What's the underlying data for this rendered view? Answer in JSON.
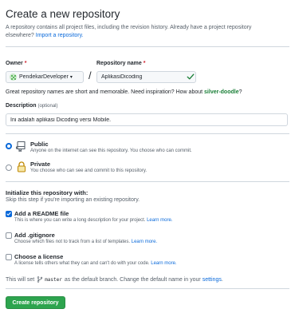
{
  "header": {
    "title": "Create a new repository",
    "subtitle": "A repository contains all project files, including the revision history. Already have a project repository elsewhere?",
    "import_link": "Import a repository."
  },
  "owner": {
    "label": "Owner",
    "required_mark": "*",
    "value": "PendekarDeveloper",
    "caret": "▾"
  },
  "separator": "/",
  "repo_name": {
    "label": "Repository name",
    "required_mark": "*",
    "value": "AplikasiDicoding",
    "valid_icon": "check-icon",
    "valid_color": "#1a7f37"
  },
  "hint": {
    "text": "Great repository names are short and memorable. Need inspiration? How about",
    "suggestion": "silver-doodle",
    "end": "?"
  },
  "description": {
    "label": "Description",
    "optional": "(optional)",
    "value": "Ini adalah aplikasi Dicoding versi Mobile."
  },
  "visibility": {
    "options": [
      {
        "title": "Public",
        "desc": "Anyone on the internet can see this repository. You choose who can commit.",
        "selected": true,
        "icon": "repo-icon"
      },
      {
        "title": "Private",
        "desc": "You choose who can see and commit to this repository.",
        "selected": false,
        "icon": "lock-icon"
      }
    ]
  },
  "initialize": {
    "heading": "Initialize this repository with:",
    "sub": "Skip this step if you're importing an existing repository.",
    "options": [
      {
        "title": "Add a README file",
        "desc": "This is where you can write a long description for your project.",
        "link": "Learn more.",
        "checked": true
      },
      {
        "title": "Add .gitignore",
        "desc": "Choose which files not to track from a list of templates.",
        "link": "Learn more.",
        "checked": false
      },
      {
        "title": "Choose a license",
        "desc": "A license tells others what they can and can't do with your code.",
        "link": "Learn more.",
        "checked": false
      }
    ]
  },
  "branch": {
    "prefix": "This will set",
    "name": "master",
    "middle": "as the default branch. Change the default name in your",
    "link": "settings",
    "end": "."
  },
  "submit": {
    "label": "Create repository",
    "color": "#2da44e"
  },
  "colors": {
    "accent": "#0969da",
    "link": "#0969da",
    "required": "#cf222e"
  }
}
